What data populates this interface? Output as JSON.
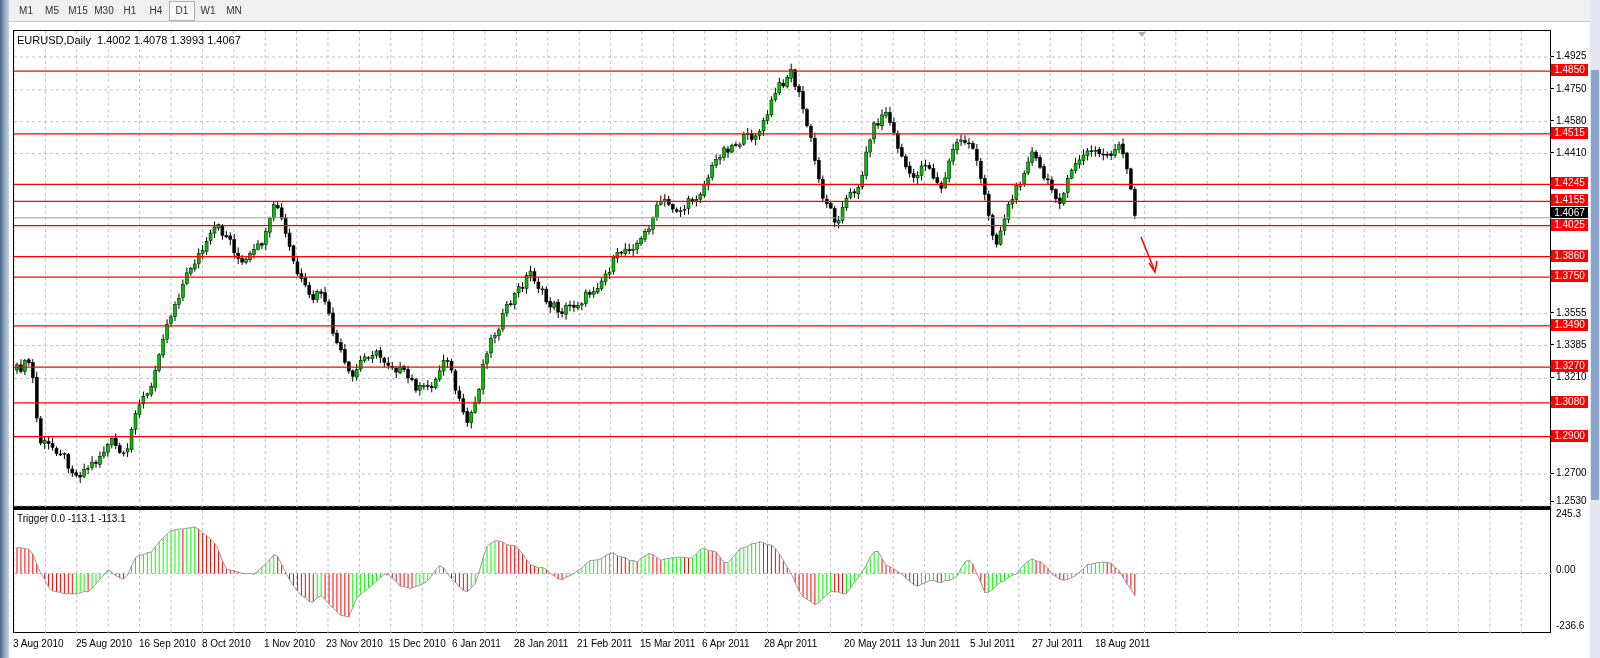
{
  "timeframes": [
    {
      "label": "M1",
      "selected": false
    },
    {
      "label": "M5",
      "selected": false
    },
    {
      "label": "M15",
      "selected": false
    },
    {
      "label": "M30",
      "selected": false
    },
    {
      "label": "H1",
      "selected": false
    },
    {
      "label": "H4",
      "selected": false
    },
    {
      "label": "D1",
      "selected": true
    },
    {
      "label": "W1",
      "selected": false
    },
    {
      "label": "MN",
      "selected": false
    }
  ],
  "chart": {
    "header": "EURUSD,Daily  1.4002 1.4078 1.3993 1.4067",
    "price_axis": [
      "1.4925",
      "1.4750",
      "1.4580",
      "1.4410",
      "1.3555",
      "1.3385",
      "1.3210",
      "1.2700",
      "1.2530"
    ],
    "levels": [
      {
        "label": "1.4850"
      },
      {
        "label": "1.4515"
      },
      {
        "label": "1.4245"
      },
      {
        "label": "1.4155"
      },
      {
        "label": "1.4025"
      },
      {
        "label": "1.3860"
      },
      {
        "label": "1.3750"
      },
      {
        "label": "1.3490"
      },
      {
        "label": "1.3270"
      },
      {
        "label": "1.3080"
      },
      {
        "label": "1.2900"
      }
    ],
    "current_price": "1.4067"
  },
  "indicator": {
    "header": "Trigger 0.0 -113.1 -113.1",
    "axis": [
      "245.3",
      "0.00",
      "-236.6"
    ]
  },
  "date_axis": [
    "3 Aug 2010",
    "25 Aug 2010",
    "16 Sep 2010",
    "8 Oct 2010",
    "1 Nov 2010",
    "23 Nov 2010",
    "15 Dec 2010",
    "6 Jan 2011",
    "28 Jan 2011",
    "21 Feb 2011",
    "15 Mar 2011",
    "6 Apr 2011",
    "28 Apr 2011",
    "20 May 2011",
    "13 Jun 2011",
    "5 Jul 2011",
    "27 Jul 2011",
    "18 Aug 2011"
  ]
}
